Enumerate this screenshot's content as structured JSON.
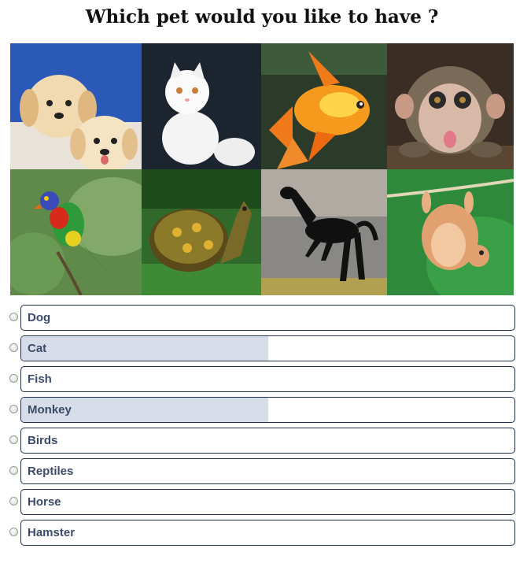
{
  "poll": {
    "question": "Which pet would you like to have ?",
    "accent_color": "#3b4b6b",
    "fill_color": "#d6dce8"
  },
  "images": [
    {
      "name": "dog-photo",
      "subject": "puppies"
    },
    {
      "name": "cat-photo",
      "subject": "white cat"
    },
    {
      "name": "fish-photo",
      "subject": "goldfish"
    },
    {
      "name": "monkey-photo",
      "subject": "monkey"
    },
    {
      "name": "bird-photo",
      "subject": "parrot"
    },
    {
      "name": "reptile-photo",
      "subject": "turtle"
    },
    {
      "name": "horse-photo",
      "subject": "black horse"
    },
    {
      "name": "hamster-photo",
      "subject": "hamster"
    }
  ],
  "options": [
    {
      "label": "Dog",
      "fill_percent": 0
    },
    {
      "label": "Cat",
      "fill_percent": 50
    },
    {
      "label": "Fish",
      "fill_percent": 0
    },
    {
      "label": "Monkey",
      "fill_percent": 50
    },
    {
      "label": "Birds",
      "fill_percent": 0
    },
    {
      "label": "Reptiles",
      "fill_percent": 0
    },
    {
      "label": "Horse",
      "fill_percent": 0
    },
    {
      "label": "Hamster",
      "fill_percent": 0
    }
  ]
}
